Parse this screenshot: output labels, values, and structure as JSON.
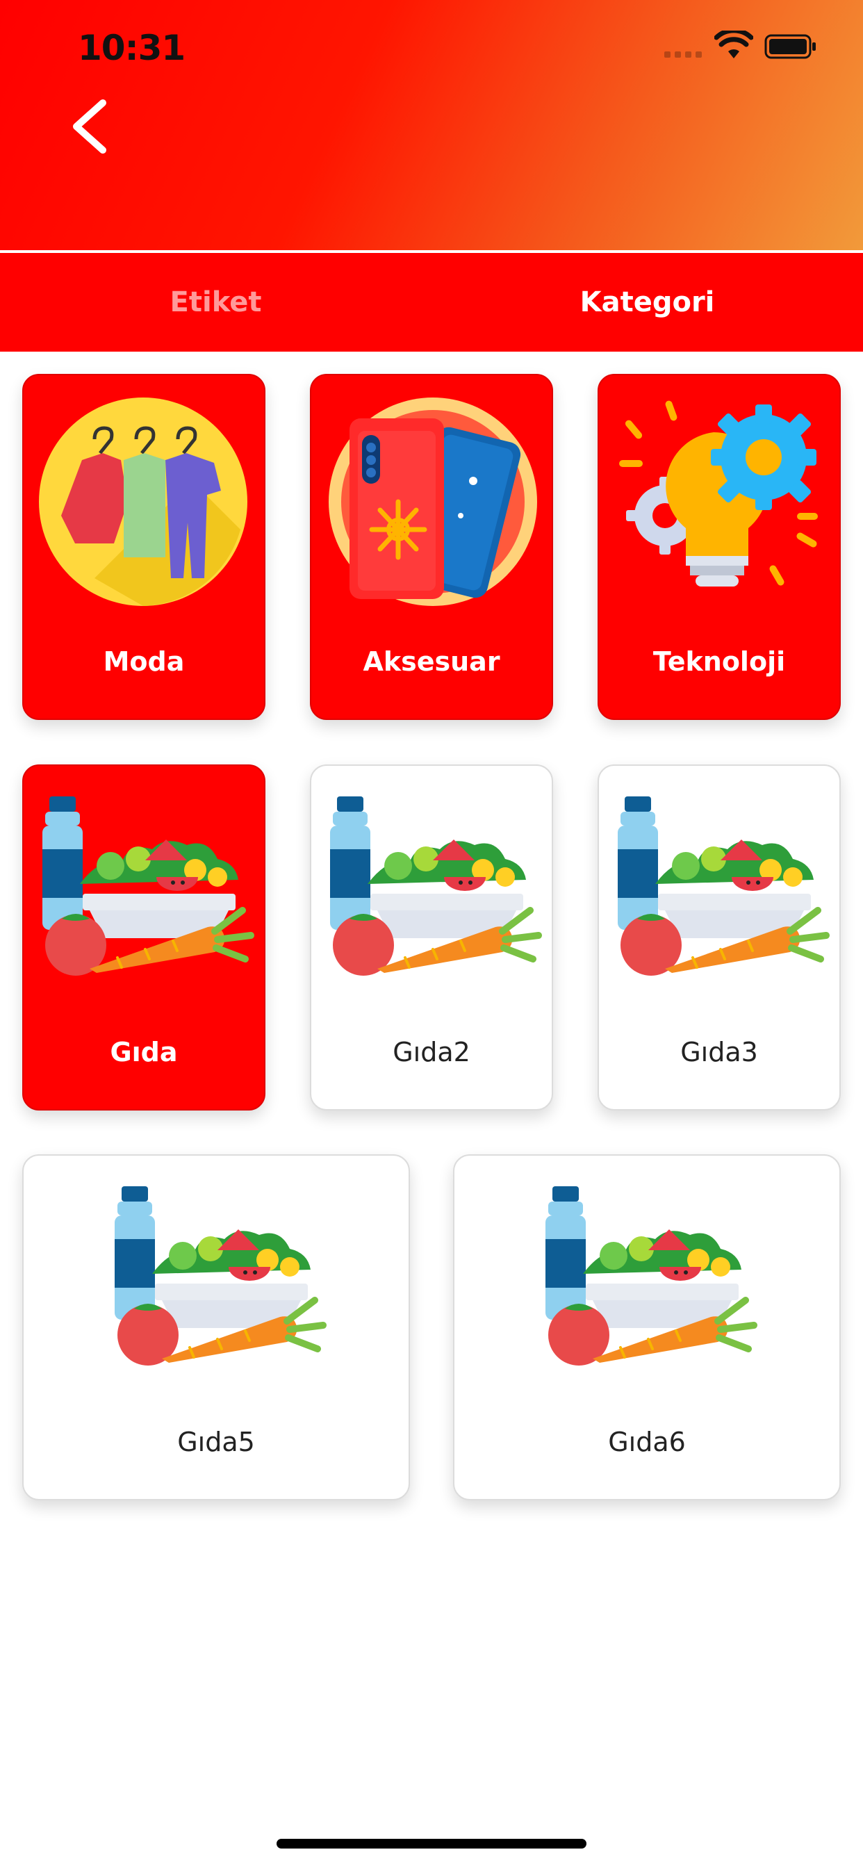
{
  "status_bar": {
    "time": "10:31"
  },
  "tabs": [
    {
      "label": "Etiket",
      "active": false
    },
    {
      "label": "Kategori",
      "active": true
    }
  ],
  "categories": [
    {
      "label": "Moda",
      "icon": "clothes-hanger-icon",
      "selected": true
    },
    {
      "label": "Aksesuar",
      "icon": "phone-case-icon",
      "selected": true
    },
    {
      "label": "Teknoloji",
      "icon": "lightbulb-gears-icon",
      "selected": true
    },
    {
      "label": "Gıda",
      "icon": "food-icon",
      "selected": true
    },
    {
      "label": "Gıda2",
      "icon": "food-icon",
      "selected": false
    },
    {
      "label": "Gıda3",
      "icon": "food-icon",
      "selected": false
    },
    {
      "label": "Gıda5",
      "icon": "food-icon",
      "selected": false
    },
    {
      "label": "Gıda6",
      "icon": "food-icon",
      "selected": false
    }
  ],
  "colors": {
    "primary": "#ff0000",
    "gradient_end": "#f29a3a",
    "selected_text": "#ffffff",
    "unselected_text": "#222222"
  }
}
